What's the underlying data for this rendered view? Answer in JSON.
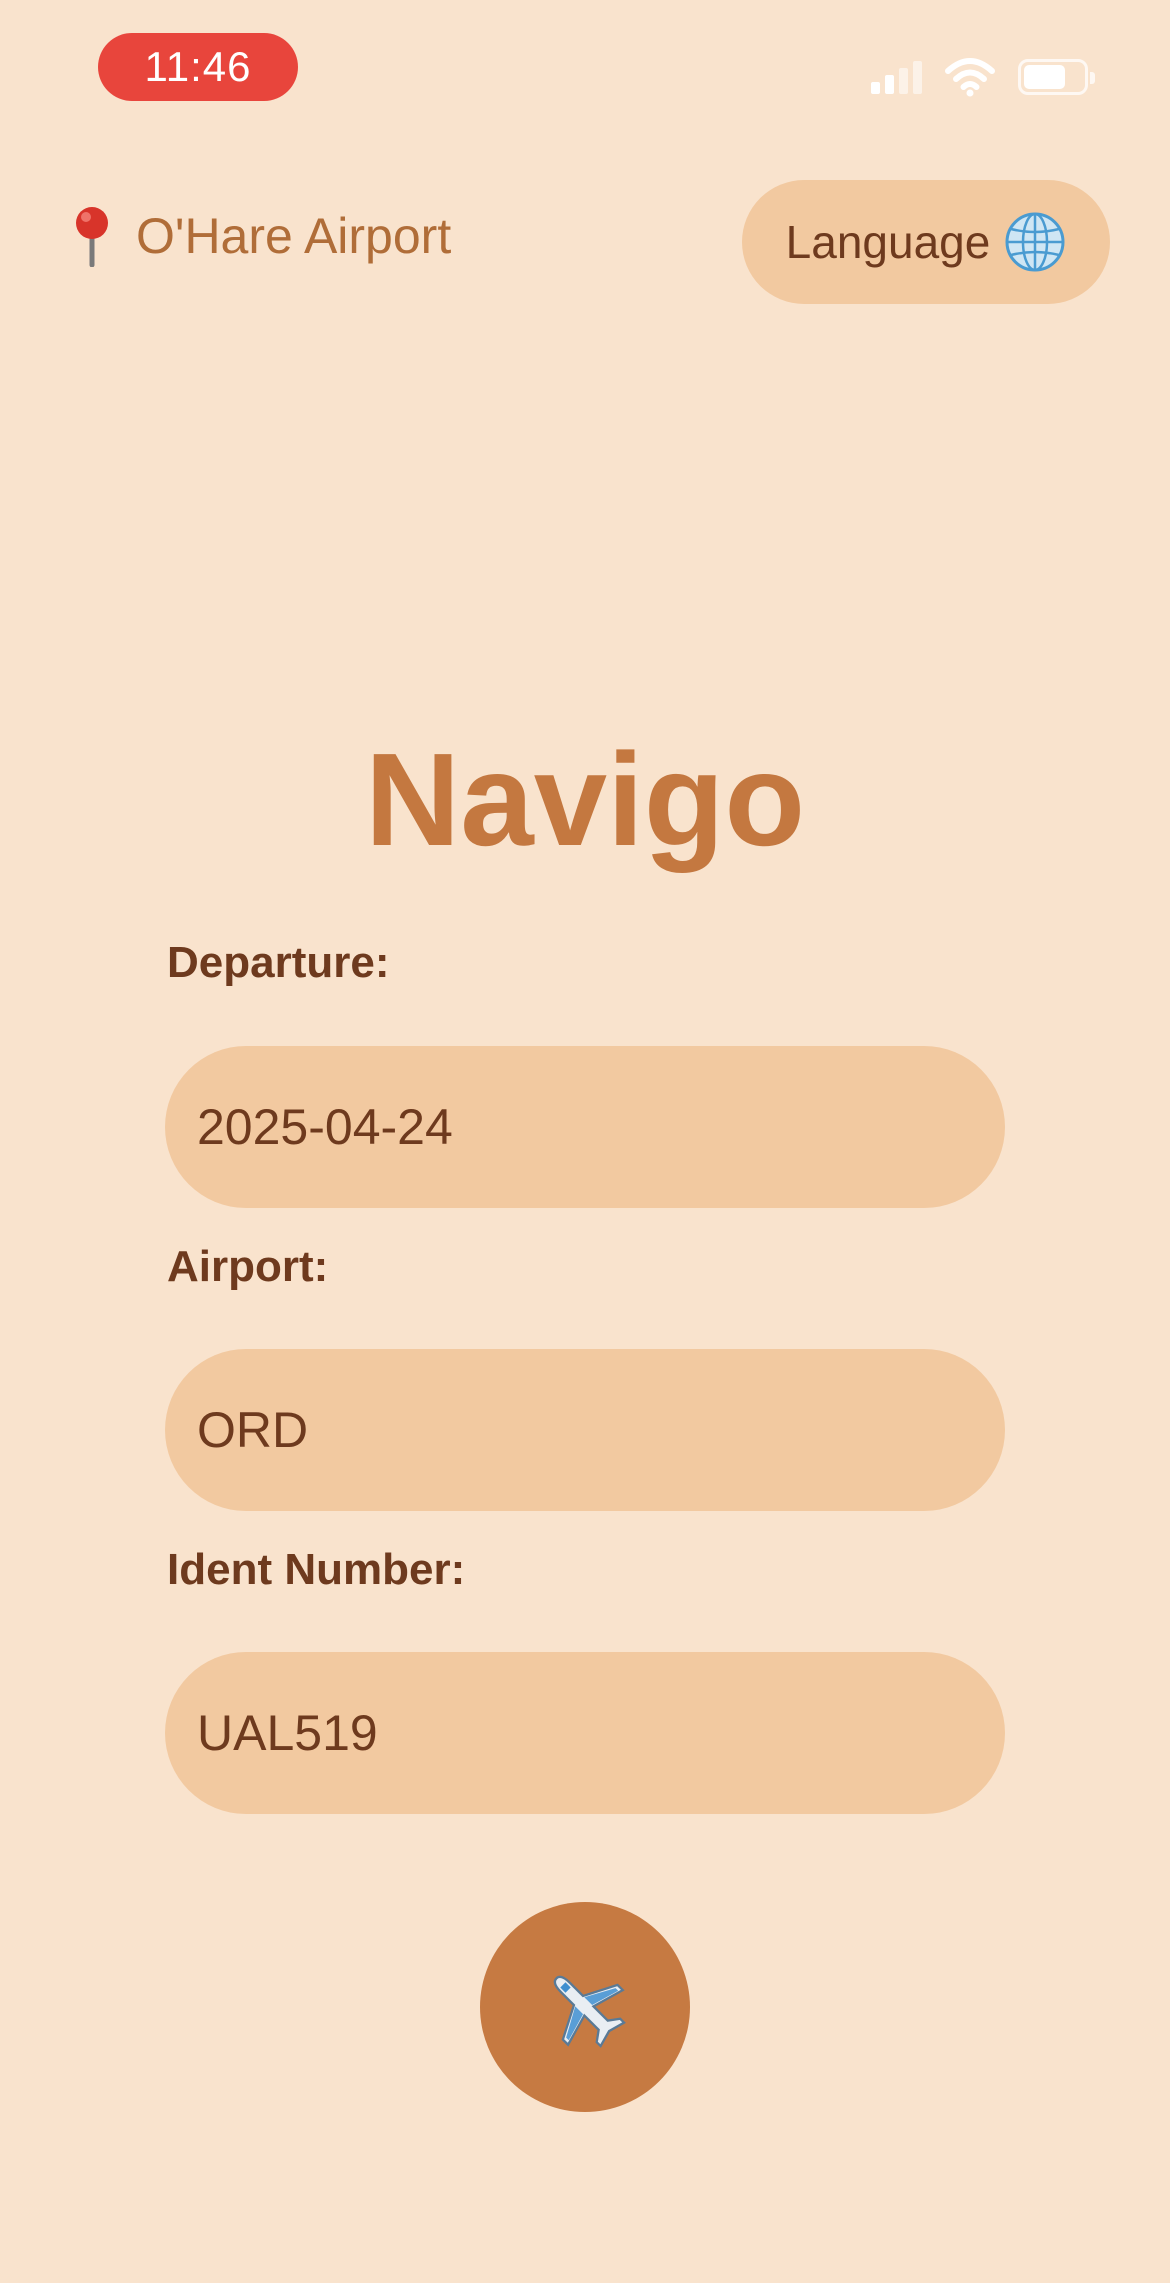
{
  "status_bar": {
    "time": "11:46",
    "time_badge_color": "#e8453c",
    "signal_icon": "cellular-signal-icon",
    "wifi_icon": "wifi-icon",
    "battery_icon": "battery-icon",
    "battery_level": 0.7
  },
  "header": {
    "location_icon": "location-pin-icon",
    "location_label": "O'Hare Airport",
    "language_button": {
      "label": "Language",
      "icon": "globe-icon"
    }
  },
  "app_title": "Navigo",
  "form": {
    "departure": {
      "label": "Departure:",
      "value": "2025-04-24"
    },
    "airport": {
      "label": "Airport:",
      "value": "ORD"
    },
    "ident": {
      "label": "Ident Number:",
      "value": "UAL519"
    }
  },
  "submit_button": {
    "icon": "airplane-icon"
  },
  "colors": {
    "background": "#f9e3cd",
    "field_fill": "#f2c9a0",
    "accent": "#c47840",
    "text_dark": "#6e3a1e"
  }
}
